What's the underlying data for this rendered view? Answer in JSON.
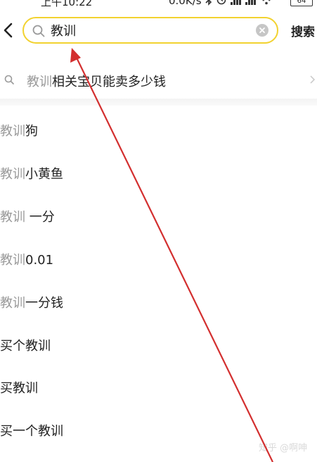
{
  "status_bar": {
    "time": "上午10:22",
    "network_speed": "0.0K/s",
    "battery": "64"
  },
  "header": {
    "search_value": "教训",
    "search_button_label": "搜索"
  },
  "related": {
    "highlight": "教训",
    "rest": "相关宝贝能卖多少钱"
  },
  "suggestions": [
    {
      "highlight": "教训",
      "rest": "狗"
    },
    {
      "highlight": "教训",
      "rest": "小黄鱼"
    },
    {
      "highlight": "教训",
      "rest": " 一分"
    },
    {
      "highlight": "教训",
      "rest": "0.01"
    },
    {
      "highlight": "教训",
      "rest": "一分钱"
    },
    {
      "highlight": "",
      "rest": "买个教训"
    },
    {
      "highlight": "",
      "rest": "买教训"
    },
    {
      "highlight": "",
      "rest": "买一个教训"
    }
  ],
  "watermark": "知乎 @啊呻",
  "colors": {
    "search_border": "#f2d230",
    "highlight_text": "#9a9a9a",
    "annotation_arrow": "#d32f2f"
  },
  "icons": [
    "back-arrow-icon",
    "search-icon",
    "clear-icon",
    "chevron-right-icon",
    "bluetooth-icon",
    "wifi-icon",
    "signal-icon",
    "battery-icon"
  ]
}
